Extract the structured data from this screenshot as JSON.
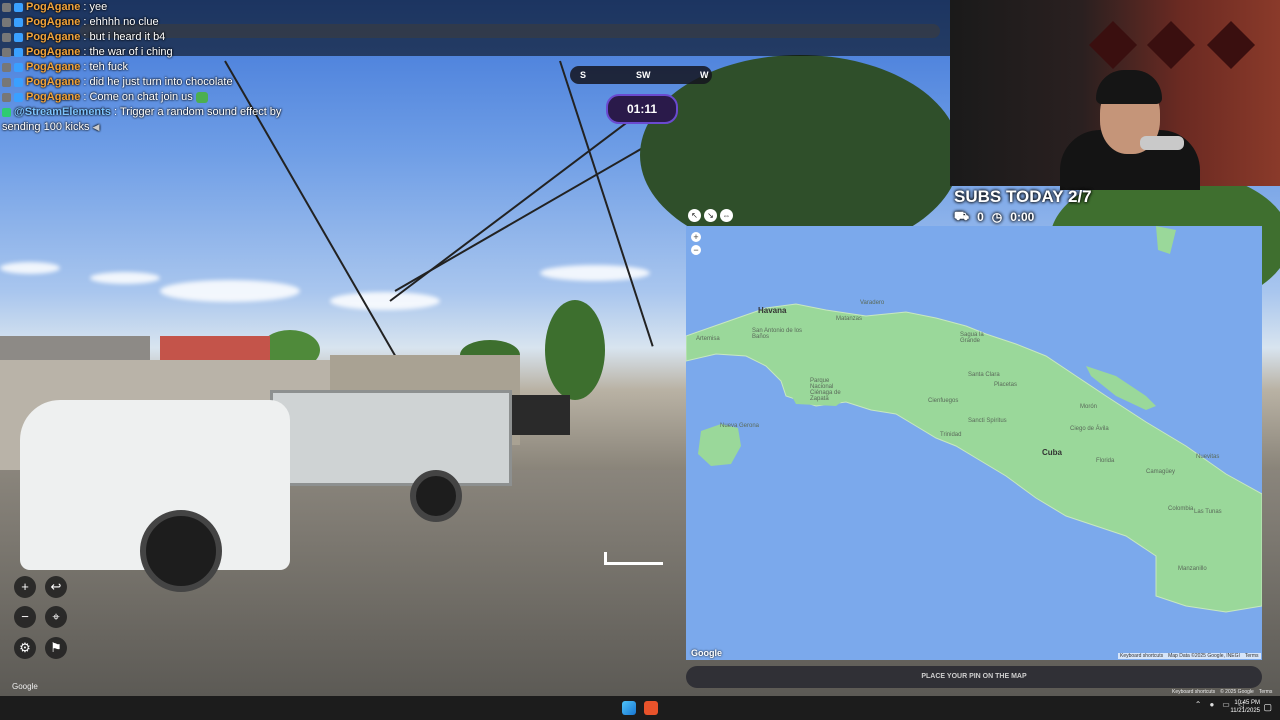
{
  "chat": {
    "messages": [
      {
        "user": "PogAgane",
        "separator": ": ",
        "text": "yee"
      },
      {
        "user": "PogAgane",
        "separator": ": ",
        "text": "ehhhh no clue"
      },
      {
        "user": "PogAgane",
        "separator": ": ",
        "text": "but i heard it b4"
      },
      {
        "user": "PogAgane",
        "separator": ": ",
        "text": "the war of i ching"
      },
      {
        "user": "PogAgane",
        "separator": ": ",
        "text": "teh fuck"
      },
      {
        "user": "PogAgane",
        "separator": ": ",
        "text": "did he just turn into chocolate"
      },
      {
        "user": "PogAgane",
        "separator": ": ",
        "text": "Come on chat join us"
      },
      {
        "user": "@StreamElements",
        "separator": " : ",
        "text": "Trigger a random sound effect by"
      }
    ],
    "continuation": "sending 100 kicks"
  },
  "compass": {
    "left": "S",
    "center": "SW",
    "right": "W"
  },
  "timer": {
    "value": "01:11"
  },
  "subs": {
    "title": "SUBS TODAY 2/7",
    "count": "0",
    "time": "0:00"
  },
  "map": {
    "zoom_in": "+",
    "zoom_out": "−",
    "labels": {
      "havana": "Havana",
      "matanzas": "Matanzas",
      "varadero": "Varadero",
      "artemisa": "Artemisa",
      "san_antonio": "San Antonio de los Baños",
      "parque_nacional": "Parque Nacional Ciénaga de Zapata",
      "nueva_gerona": "Nueva Gerona",
      "sagua": "Sagua la Grande",
      "santa_clara": "Santa Clara",
      "placetas": "Placetas",
      "cienfuegos": "Cienfuegos",
      "sancti_spiritus": "Sancti Spíritus",
      "trinidad": "Trinidad",
      "moron": "Morón",
      "ciego": "Ciego de Ávila",
      "cuba": "Cuba",
      "florida": "Florida",
      "camaguey": "Camagüey",
      "nuevitas": "Nuevitas",
      "colombia": "Colombia",
      "las_tunas": "Las Tunas",
      "manzanillo": "Manzanillo"
    },
    "google_logo": "Google",
    "footer": {
      "shortcuts": "Keyboard shortcuts",
      "data": "Map Data ©2025 Google, INEGI",
      "terms": "Terms"
    },
    "place_pin": "PLACE YOUR PIN ON THE MAP"
  },
  "streetview": {
    "zoom_in": "+",
    "undo": "↩",
    "zoom_out": "−",
    "checkpoint": "⌖",
    "settings": "⚙",
    "flag": "⚑",
    "google": "Google",
    "footer": {
      "shortcuts": "Keyboard shortcuts",
      "copyright": "© 2025 Google",
      "terms": "Terms"
    }
  },
  "taskbar": {
    "time": "10:45 PM",
    "date": "11/21/2025"
  },
  "colors": {
    "accent": "#6a4ad0",
    "chat_user": "#f2a33a",
    "map_land": "#9ad89a",
    "map_water": "#7ba9ec"
  }
}
